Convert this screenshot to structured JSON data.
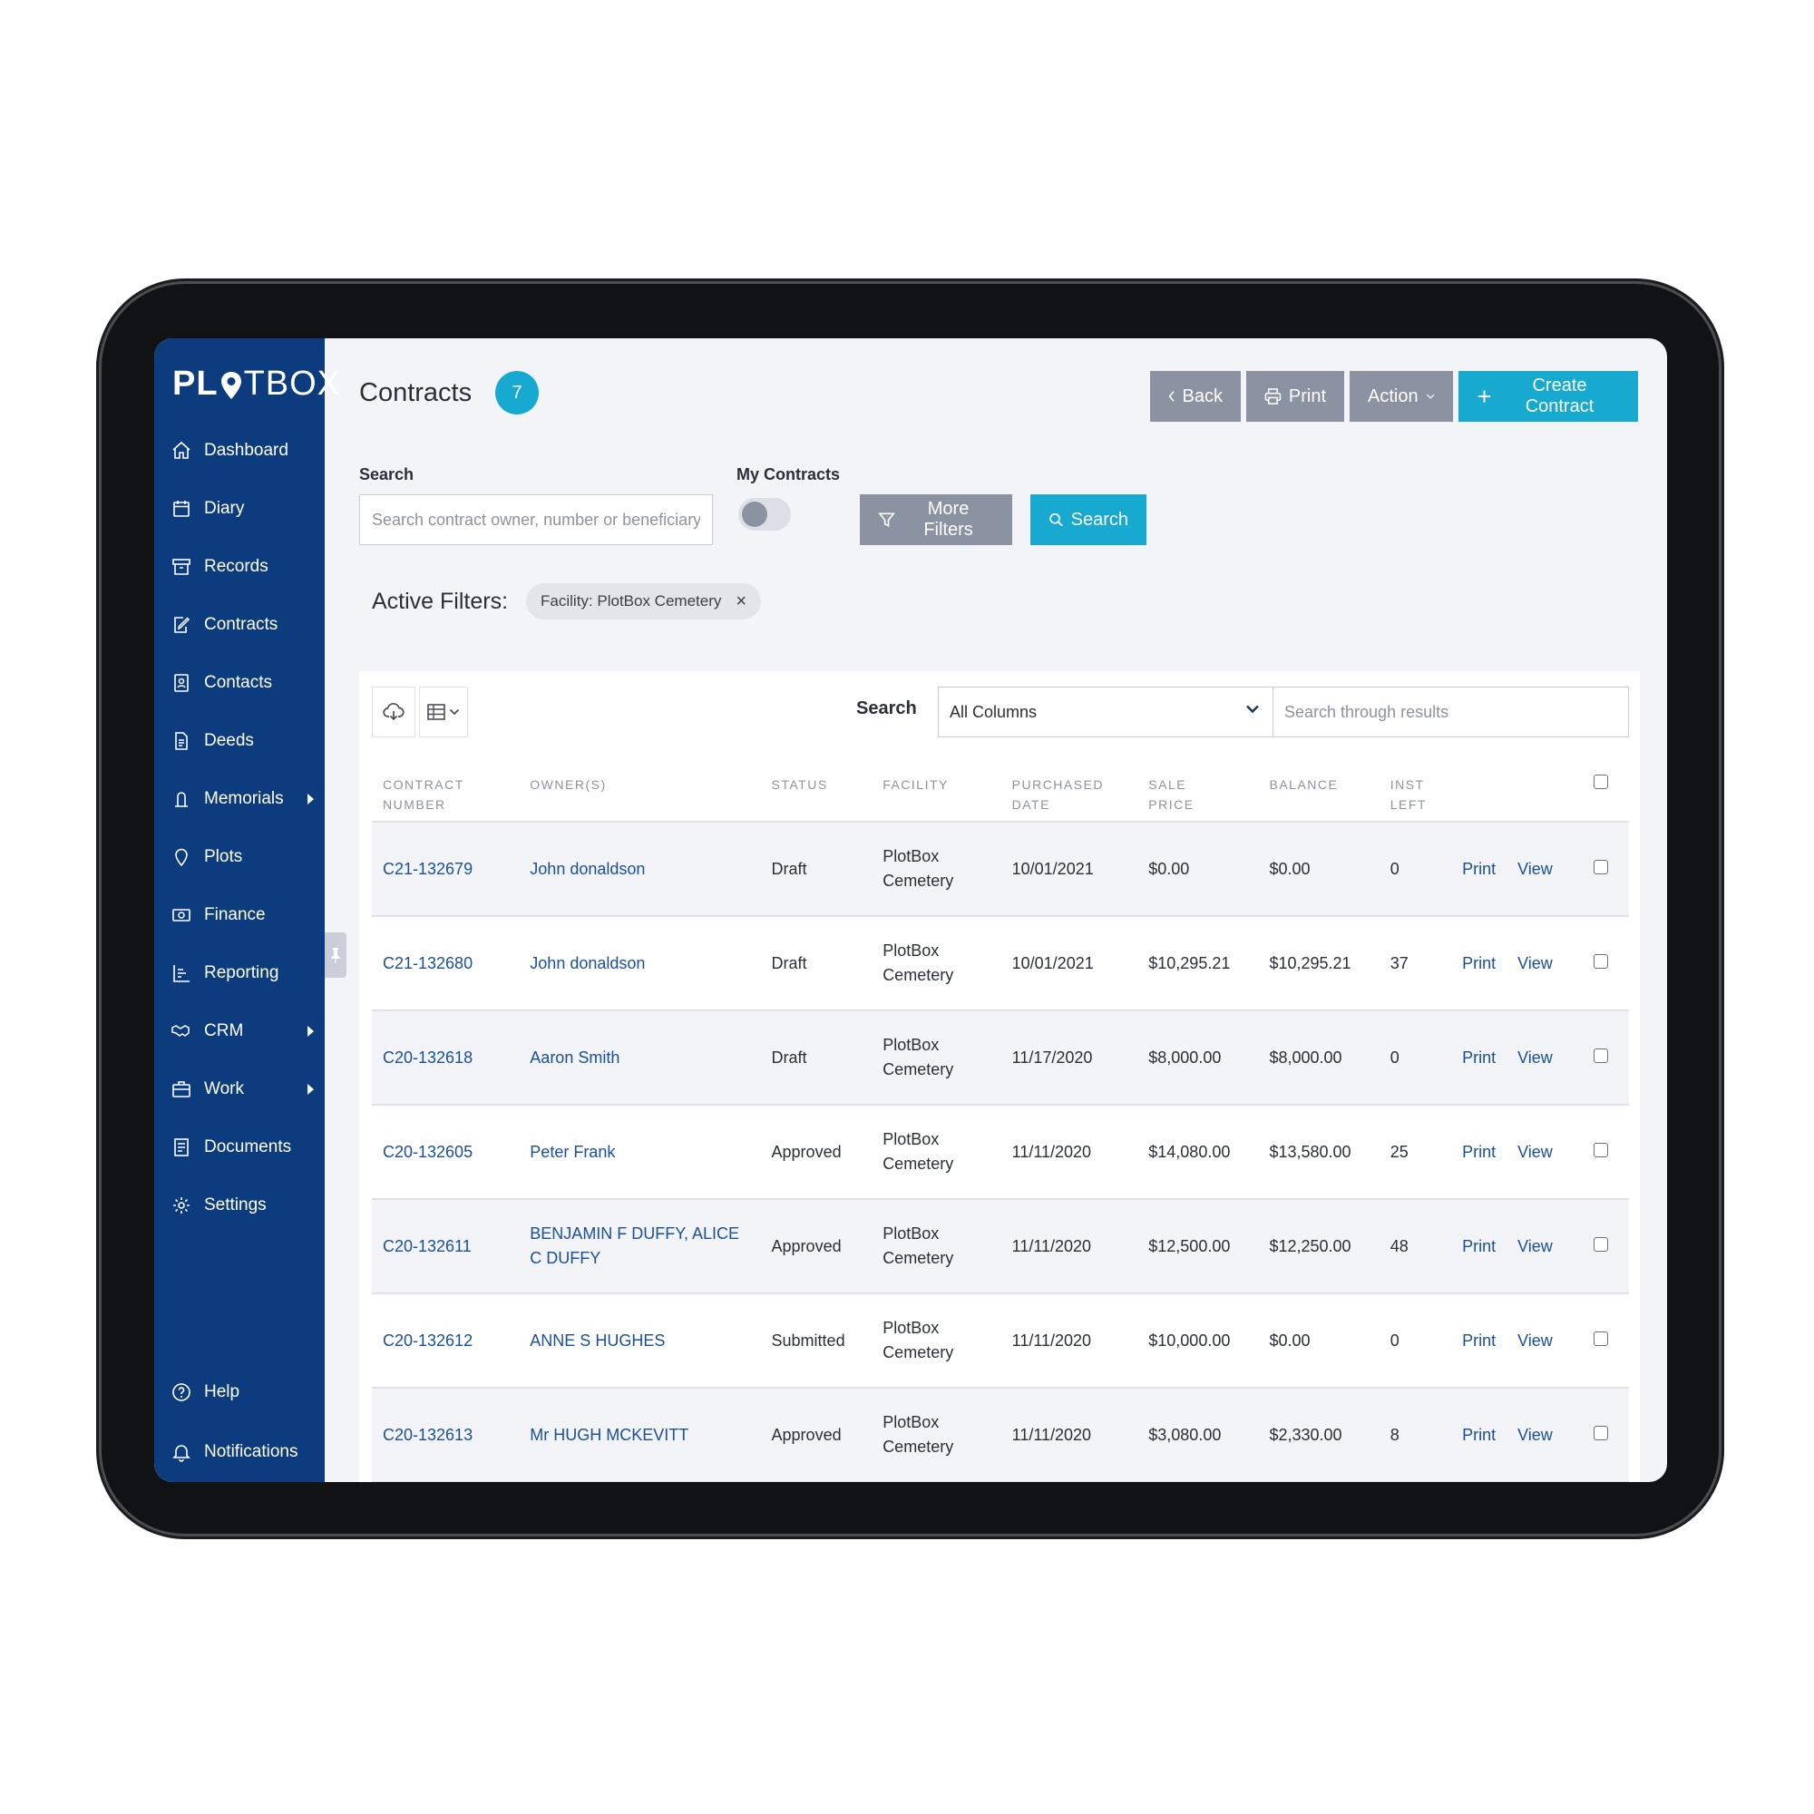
{
  "brand": {
    "logo_left": "PL",
    "logo_right": "TBOX"
  },
  "sidebar": {
    "items": [
      {
        "label": "Dashboard",
        "icon": "home-icon"
      },
      {
        "label": "Diary",
        "icon": "calendar-icon"
      },
      {
        "label": "Records",
        "icon": "archive-icon"
      },
      {
        "label": "Contracts",
        "icon": "contract-icon"
      },
      {
        "label": "Contacts",
        "icon": "contacts-icon"
      },
      {
        "label": "Deeds",
        "icon": "deed-icon"
      },
      {
        "label": "Memorials",
        "icon": "memorial-icon",
        "submenu": true
      },
      {
        "label": "Plots",
        "icon": "map-pin-icon"
      },
      {
        "label": "Finance",
        "icon": "money-icon"
      },
      {
        "label": "Reporting",
        "icon": "report-icon"
      },
      {
        "label": "CRM",
        "icon": "handshake-icon",
        "submenu": true
      },
      {
        "label": "Work",
        "icon": "briefcase-icon",
        "submenu": true
      },
      {
        "label": "Documents",
        "icon": "documents-icon"
      },
      {
        "label": "Settings",
        "icon": "gear-icon"
      }
    ],
    "bottom": [
      {
        "label": "Help",
        "icon": "help-icon"
      },
      {
        "label": "Notifications",
        "icon": "bell-icon"
      }
    ]
  },
  "header": {
    "title": "Contracts",
    "count": "7",
    "back_label": "Back",
    "print_label": "Print",
    "action_label": "Action",
    "create_label": "Create Contract"
  },
  "filters": {
    "search_label": "Search",
    "search_placeholder": "Search contract owner, number or beneficiary",
    "my_contracts_label": "My Contracts",
    "more_filters_label": "More Filters",
    "search_button_label": "Search",
    "active_label": "Active Filters:",
    "active_chip": "Facility: PlotBox Cemetery",
    "chip_close": "×"
  },
  "table_tools": {
    "search_label": "Search",
    "column_select": "All Columns",
    "results_placeholder": "Search through results"
  },
  "table": {
    "headers": [
      [
        "CONTRACT",
        "NUMBER"
      ],
      [
        "OWNER(S)",
        ""
      ],
      [
        "STATUS",
        ""
      ],
      [
        "FACILITY",
        ""
      ],
      [
        "PURCHASED",
        "DATE"
      ],
      [
        "SALE",
        "PRICE"
      ],
      [
        "BALANCE",
        ""
      ],
      [
        "INST",
        "LEFT"
      ]
    ],
    "action_print": "Print",
    "action_view": "View",
    "rows": [
      {
        "number": "C21-132679",
        "owner": "John donaldson",
        "status": "Draft",
        "facility": "PlotBox Cemetery",
        "date": "10/01/2021",
        "price": "$0.00",
        "balance": "$0.00",
        "inst": "0"
      },
      {
        "number": "C21-132680",
        "owner": "John donaldson",
        "status": "Draft",
        "facility": "PlotBox Cemetery",
        "date": "10/01/2021",
        "price": "$10,295.21",
        "balance": "$10,295.21",
        "inst": "37"
      },
      {
        "number": "C20-132618",
        "owner": "Aaron Smith",
        "status": "Draft",
        "facility": "PlotBox Cemetery",
        "date": "11/17/2020",
        "price": "$8,000.00",
        "balance": "$8,000.00",
        "inst": "0"
      },
      {
        "number": "C20-132605",
        "owner": "Peter Frank",
        "status": "Approved",
        "facility": "PlotBox Cemetery",
        "date": "11/11/2020",
        "price": "$14,080.00",
        "balance": "$13,580.00",
        "inst": "25"
      },
      {
        "number": "C20-132611",
        "owner": "BENJAMIN F DUFFY, ALICE C DUFFY",
        "status": "Approved",
        "facility": "PlotBox Cemetery",
        "date": "11/11/2020",
        "price": "$12,500.00",
        "balance": "$12,250.00",
        "inst": "48"
      },
      {
        "number": "C20-132612",
        "owner": "ANNE S HUGHES",
        "status": "Submitted",
        "facility": "PlotBox Cemetery",
        "date": "11/11/2020",
        "price": "$10,000.00",
        "balance": "$0.00",
        "inst": "0"
      },
      {
        "number": "C20-132613",
        "owner": "Mr HUGH MCKEVITT",
        "status": "Approved",
        "facility": "PlotBox Cemetery",
        "date": "11/11/2020",
        "price": "$3,080.00",
        "balance": "$2,330.00",
        "inst": "8"
      }
    ]
  },
  "colors": {
    "sidebar": "#0c3c7d",
    "accent": "#17a9cf",
    "button_gray": "#8b93a3",
    "link": "#1a4f99"
  }
}
